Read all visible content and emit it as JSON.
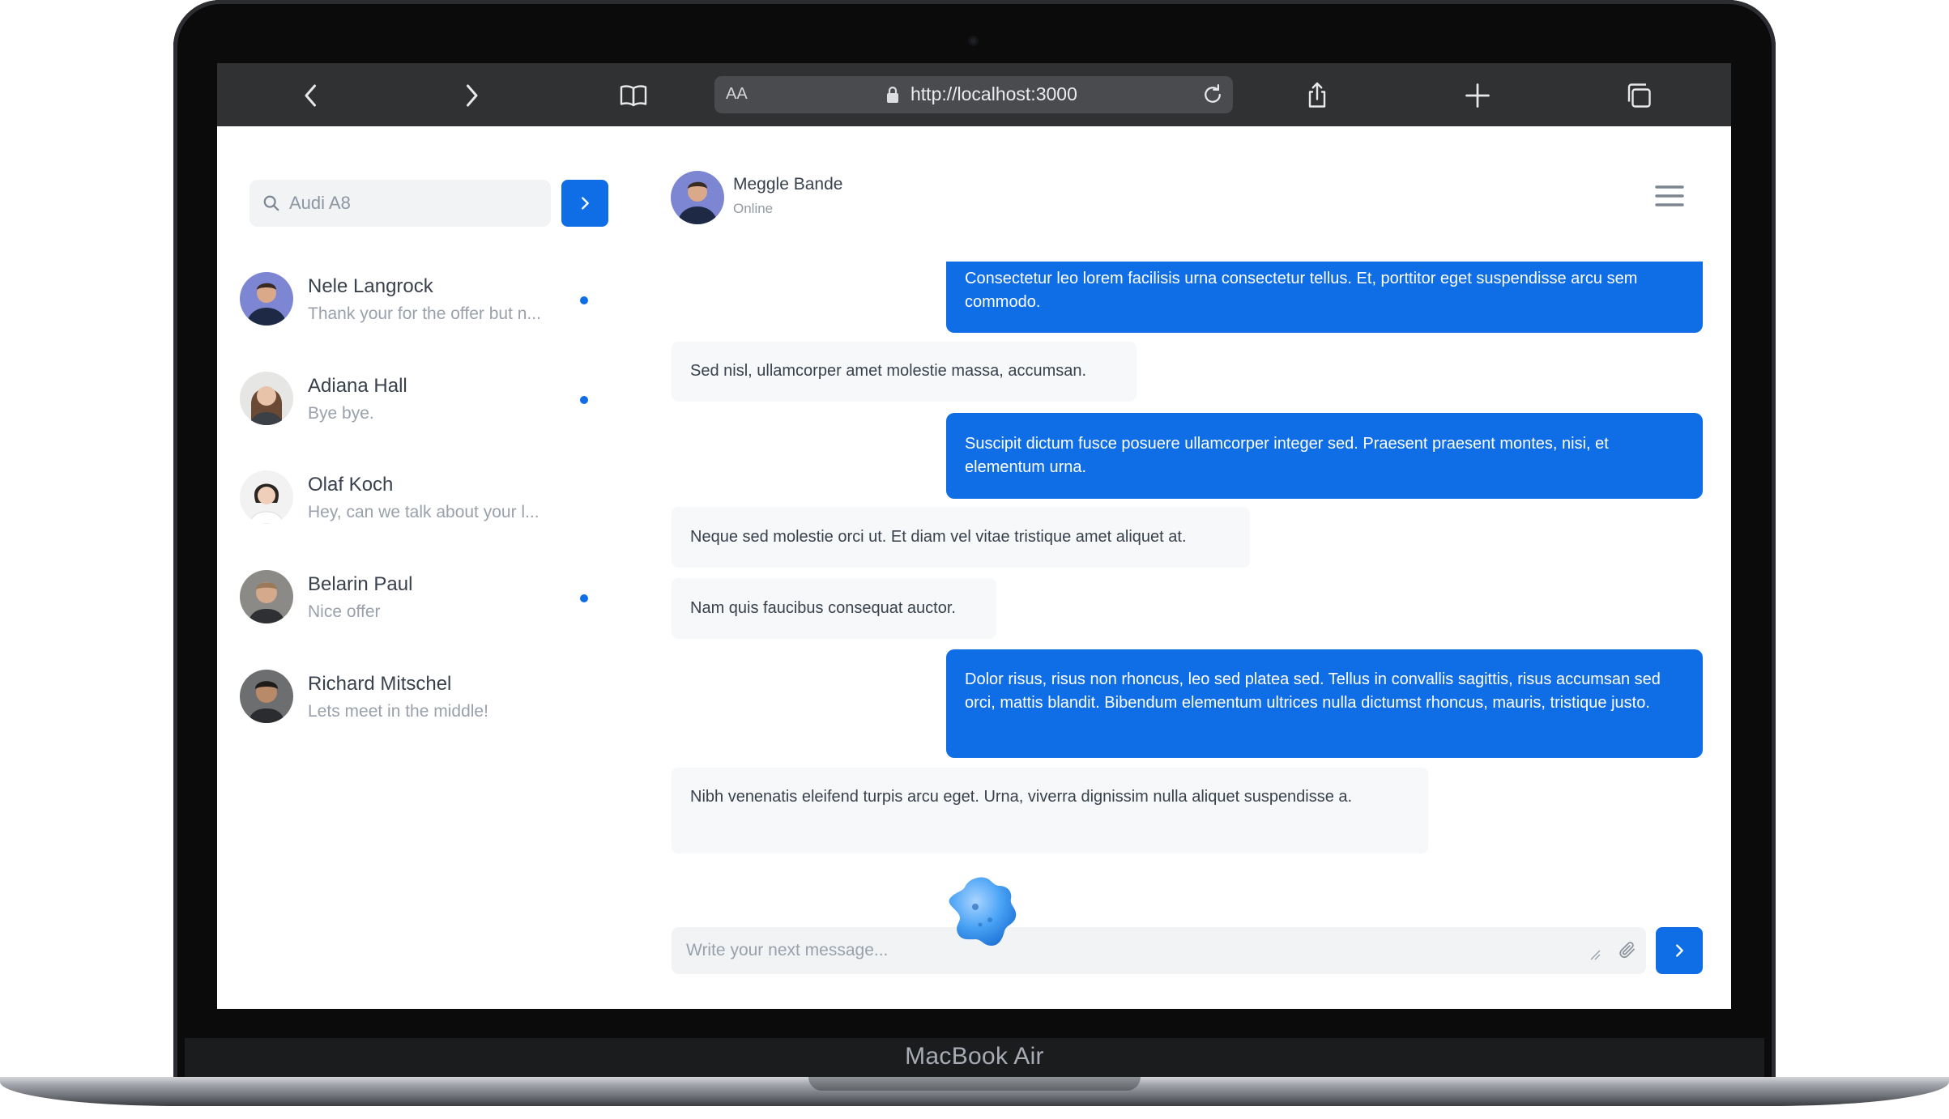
{
  "device": {
    "brand_label": "MacBook Air"
  },
  "browser": {
    "url_prefix": "AA",
    "url": "http://localhost:3000",
    "icons": [
      "back-icon",
      "forward-icon",
      "bookmarks-icon",
      "lock-icon",
      "reload-icon",
      "share-icon",
      "new-tab-icon",
      "tabs-icon"
    ]
  },
  "sidebar": {
    "search": {
      "value": "Audi A8"
    },
    "contacts": [
      {
        "name": "Nele Langrock",
        "preview": "Thank your for the offer but n...",
        "unread": true
      },
      {
        "name": "Adiana Hall",
        "preview": "Bye bye.",
        "unread": true
      },
      {
        "name": "Olaf Koch",
        "preview": "Hey, can we talk about your l...",
        "unread": false
      },
      {
        "name": "Belarin Paul",
        "preview": "Nice offer",
        "unread": true
      },
      {
        "name": "Richard Mitschel",
        "preview": "Lets meet in the middle!",
        "unread": false
      }
    ]
  },
  "chat": {
    "contact_name": "Meggle Bande",
    "status": "Online",
    "messages": [
      {
        "direction": "out",
        "text": "Consectetur leo lorem facilisis urna consectetur tellus. Et, porttitor eget suspendisse arcu sem commodo."
      },
      {
        "direction": "in",
        "text": "Sed nisl, ullamcorper amet molestie massa, accumsan."
      },
      {
        "direction": "out",
        "text": "Suscipit dictum fusce posuere ullamcorper integer sed. Praesent praesent montes, nisi, et elementum urna."
      },
      {
        "direction": "in",
        "text": "Neque sed molestie orci ut. Et diam vel vitae tristique amet aliquet at."
      },
      {
        "direction": "in",
        "text": "Nam quis faucibus consequat auctor."
      },
      {
        "direction": "out",
        "text": "Dolor risus, risus non rhoncus, leo sed platea sed. Tellus in convallis sagittis, risus accumsan sed orci, mattis blandit. Bibendum elementum ultrices nulla dictumst rhoncus, mauris, tristique justo."
      },
      {
        "direction": "in",
        "text": "Nibh venenatis eleifend turpis arcu eget. Urna, viverra dignissim nulla aliquet suspendisse a."
      }
    ],
    "composer": {
      "placeholder": "Write your next message..."
    }
  },
  "colors": {
    "accent": "#0f6ee6",
    "unread_dot": "#0f6ee6",
    "toolbar": "#303133"
  }
}
